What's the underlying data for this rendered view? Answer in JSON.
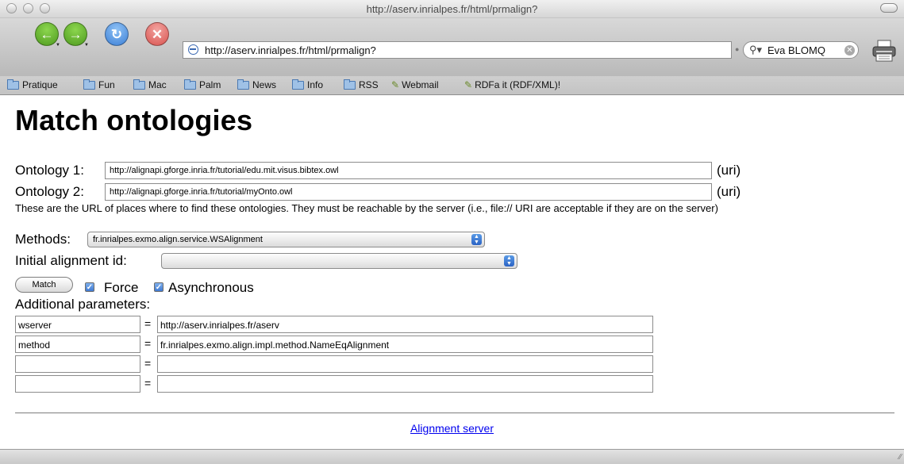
{
  "browser": {
    "window_title": "http://aserv.inrialpes.fr/html/prmalign?",
    "address": "http://aserv.inrialpes.fr/html/prmalign?",
    "search_value": "Eva BLOMQ",
    "bookmarks": [
      {
        "label": "Pratique",
        "icon": "folder-icon"
      },
      {
        "label": "Fun",
        "icon": "folder-icon"
      },
      {
        "label": "Mac",
        "icon": "folder-icon"
      },
      {
        "label": "Palm",
        "icon": "folder-icon"
      },
      {
        "label": "News",
        "icon": "folder-icon"
      },
      {
        "label": "Info",
        "icon": "folder-icon"
      },
      {
        "label": "RSS",
        "icon": "folder-icon"
      },
      {
        "label": "Webmail",
        "icon": "bookmarklet-icon"
      },
      {
        "label": "RDFa it (RDF/XML)!",
        "icon": "bookmarklet-icon"
      }
    ],
    "colors": {
      "back_forward": "#4e9a1f",
      "reload": "#3c7fd6",
      "stop": "#d9534f",
      "link": "#0000ee"
    }
  },
  "page": {
    "title": "Match ontologies",
    "ontology1": {
      "label": "Ontology 1:",
      "value": "http://alignapi.gforge.inria.fr/tutorial/edu.mit.visus.bibtex.owl",
      "suffix": "(uri)"
    },
    "ontology2": {
      "label": "Ontology 2:",
      "value": "http://alignapi.gforge.inria.fr/tutorial/myOnto.owl",
      "suffix": "(uri)"
    },
    "help_text": "These are the URL of places where to find these ontologies. They must be reachable by the server (i.e., file:// URI are acceptable if they are on the server)",
    "methods": {
      "label": "Methods:",
      "selected": "fr.inrialpes.exmo.align.service.WSAlignment"
    },
    "initial_alignment": {
      "label": "Initial alignment id:",
      "selected": ""
    },
    "match_button": "Match",
    "force": {
      "label": "Force",
      "checked": true
    },
    "asynchronous": {
      "label": "Asynchronous",
      "checked": true
    },
    "additional_label": "Additional parameters:",
    "params": [
      {
        "key": "wserver",
        "value": "http://aserv.inrialpes.fr/aserv"
      },
      {
        "key": "method",
        "value": "fr.inrialpes.exmo.align.impl.method.NameEqAlignment"
      },
      {
        "key": "",
        "value": ""
      },
      {
        "key": "",
        "value": ""
      }
    ],
    "eq_sign": "=",
    "footer_link": "Alignment server"
  }
}
